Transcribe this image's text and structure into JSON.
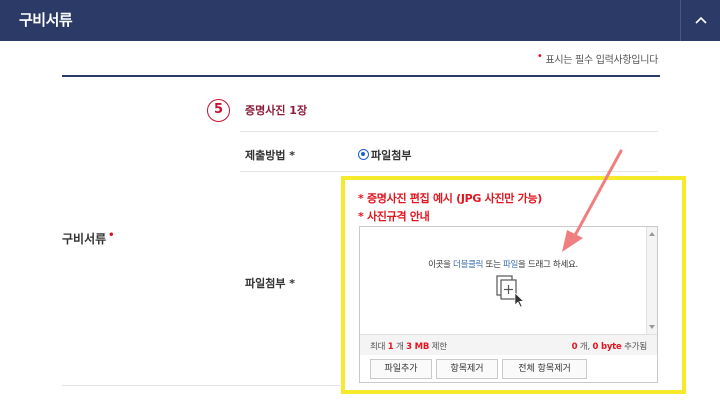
{
  "header": {
    "title": "구비서류"
  },
  "required_notice": {
    "marker": "•",
    "text": "표시는 필수 입력사항입니다"
  },
  "section": {
    "label": "구비서류",
    "required_marker": "•"
  },
  "step": {
    "number": "5",
    "title": "증명사진 1장"
  },
  "submission": {
    "label": "제출방법 *",
    "option_label": "파일첨부",
    "option_selected": true
  },
  "attach": {
    "label": "파일첨부 *"
  },
  "links": {
    "example": "* 증명사진 편집 예시 (JPG 사진만 가능)",
    "guide": "* 사진규격 안내"
  },
  "upload": {
    "drop_text_1": "이곳을 ",
    "drop_text_dblclick": "더블클릭",
    "drop_text_2": " 또는 ",
    "drop_text_file": "파일",
    "drop_text_3": "을 드래그 하세요.",
    "limit_prefix": "최대 ",
    "limit_count": "1",
    "limit_mid": " 개 ",
    "limit_size": "3 MB",
    "limit_suffix": " 제한",
    "added_count": "0",
    "added_mid": " 개, ",
    "added_size": "0 byte",
    "added_suffix": " 추가됨",
    "buttons": {
      "add": "파일추가",
      "remove": "항목제거",
      "remove_all": "전체 항목제거"
    }
  },
  "colors": {
    "header_bg": "#2b3a67",
    "required": "#d6111e",
    "highlight": "#f7ea2b",
    "arrow": "#f08080"
  }
}
